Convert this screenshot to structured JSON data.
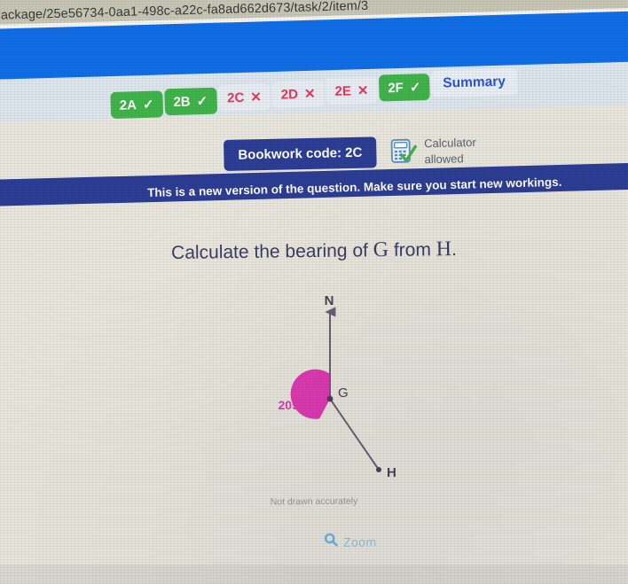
{
  "browser": {
    "url": "ackage/25e56734-0aa1-498c-a22c-fa8ad662d673/task/2/item/3"
  },
  "tabs": [
    {
      "label": "2A",
      "mark": "✓",
      "state": "correct"
    },
    {
      "label": "2B",
      "mark": "✓",
      "state": "correct"
    },
    {
      "label": "2C",
      "mark": "✕",
      "state": "wrong"
    },
    {
      "label": "2D",
      "mark": "✕",
      "state": "wrong"
    },
    {
      "label": "2E",
      "mark": "✕",
      "state": "wrong"
    },
    {
      "label": "2F",
      "mark": "✓",
      "state": "correct"
    },
    {
      "label": "Summary",
      "mark": "",
      "state": "summary"
    }
  ],
  "bookwork": {
    "code_label": "Bookwork code: 2C",
    "calculator_line1": "Calculator",
    "calculator_line2": "allowed",
    "calculator_icon": "calculator-allowed-icon"
  },
  "notice": {
    "text": "This is a new version of the question. Make sure you start new workings."
  },
  "question": {
    "prefix": "Calculate the bearing of ",
    "point_from": "G",
    "middle": " from ",
    "point_to": "H",
    "suffix": "."
  },
  "diagram": {
    "north_label": "N",
    "vertex_label": "G",
    "target_label": "H",
    "angle_label": "205°",
    "disclaimer": "Not drawn accurately",
    "angle_value": 205,
    "accent_color": "#e03ab4",
    "line_color": "#6b5f78"
  },
  "zoom": {
    "label": "Zoom",
    "icon": "magnifier-icon"
  },
  "colors": {
    "blue_bar": "#0f6fe8",
    "notice_blue": "#2c3e96",
    "correct_green": "#3fb54a",
    "wrong_red": "#e8395c",
    "summary_blue": "#2b55d4",
    "magenta": "#e03ab4",
    "page_bg": "#eae7de"
  }
}
